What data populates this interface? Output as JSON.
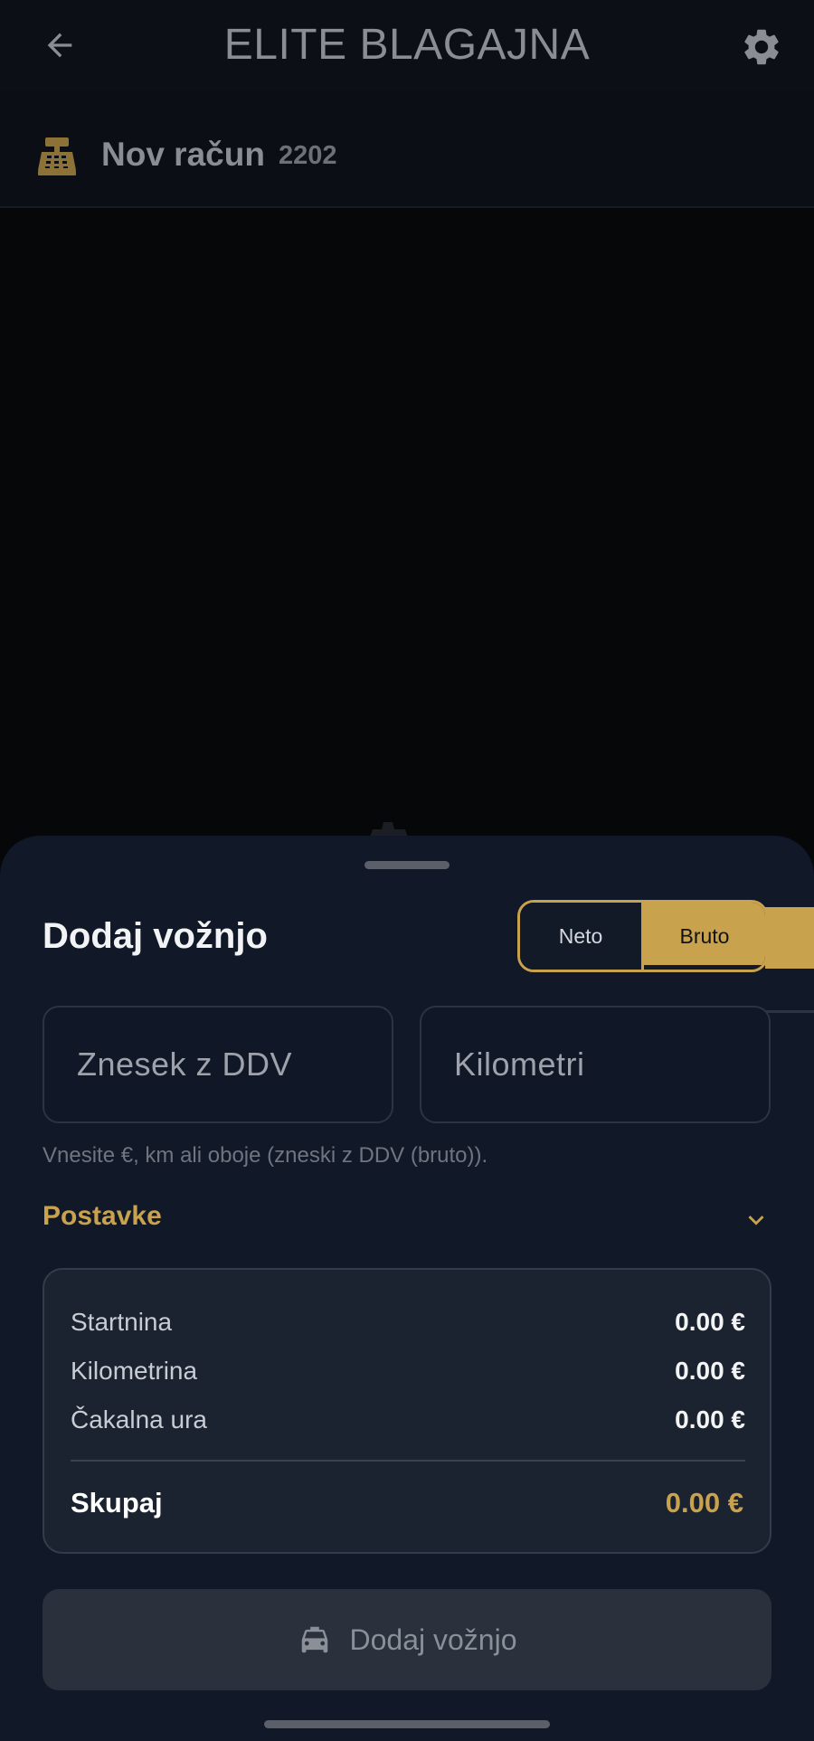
{
  "app_bar": {
    "title": "ELITE BLAGAJNA",
    "back_icon": "arrow-left-icon",
    "settings_icon": "gear-icon"
  },
  "receipt": {
    "icon": "cash-register-icon",
    "title": "Nov račun",
    "number": "2202"
  },
  "sheet": {
    "title": "Dodaj vožnjo",
    "mode_toggle": {
      "options": [
        "Neto",
        "Bruto"
      ],
      "selected": "Bruto"
    },
    "fields": {
      "amount": {
        "placeholder": "Znesek z DDV",
        "value": ""
      },
      "km": {
        "placeholder": "Kilometri",
        "value": ""
      }
    },
    "hint": "Vnesite €, km ali oboje (zneski z DDV (bruto)).",
    "settings_section": {
      "label": "Postavke",
      "icon": "chevron-down-icon"
    },
    "summary": {
      "rows": [
        {
          "label": "Startnina",
          "value": "0.00 €"
        },
        {
          "label": "Kilometrina",
          "value": "0.00 €"
        },
        {
          "label": "Čakalna ura",
          "value": "0.00 €"
        }
      ],
      "total_label": "Skupaj",
      "total_value": "0.00 €"
    },
    "submit_button": {
      "label": "Dodaj vožnjo",
      "icon": "taxi-icon",
      "enabled": false
    }
  },
  "colors": {
    "accent": "#c9a24e",
    "sheet_bg": "#111827",
    "card_bg": "#1b2230",
    "app_bar_bg": "#0c0f16"
  }
}
